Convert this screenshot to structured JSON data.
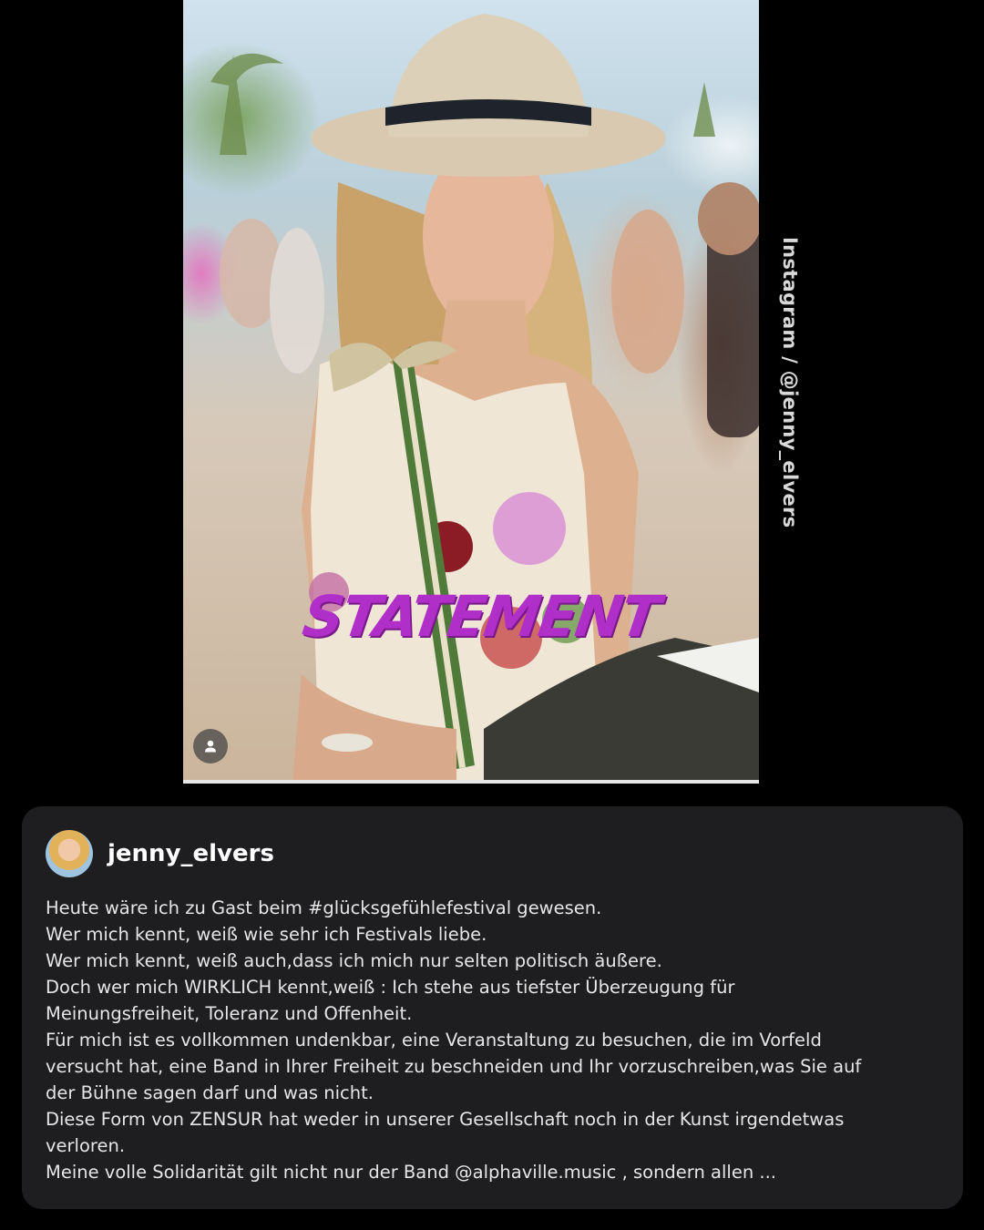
{
  "post": {
    "overlay_text": "STATEMENT",
    "credit": "Instagram / @jenny_elvers",
    "accent_color": "#b02fc8"
  },
  "author": {
    "username": "jenny_elvers"
  },
  "caption": {
    "lines": [
      "Heute wäre ich zu Gast beim #glücksgefühlefestival gewesen.",
      "Wer mich kennt, weiß wie sehr ich Festivals liebe.",
      "Wer mich kennt, weiß auch,dass ich mich nur selten politisch äußere.",
      "Doch wer mich WIRKLICH kennt,weiß : Ich stehe aus tiefster Überzeugung für",
      "Meinungsfreiheit, Toleranz und Offenheit.",
      "Für mich ist es vollkommen undenkbar, eine Veranstaltung zu besuchen, die im Vorfeld",
      "versucht hat, eine Band in Ihrer Freiheit zu beschneiden und Ihr vorzuschreiben,was Sie auf",
      "der Bühne sagen darf und was nicht.",
      "Diese Form von ZENSUR hat weder in unserer Gesellschaft noch in der Kunst irgendetwas",
      "verloren.",
      "Meine volle Solidarität gilt nicht nur der Band @alphaville.music , sondern allen ..."
    ]
  },
  "icons": {
    "user_badge": "person-icon"
  }
}
